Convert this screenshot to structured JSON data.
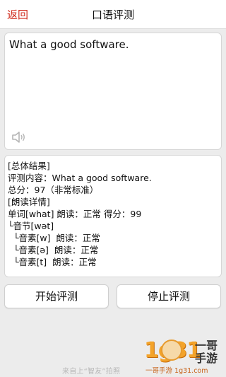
{
  "header": {
    "back_label": "返回",
    "title": "口语评测"
  },
  "input": {
    "text": "What a good software.",
    "speaker_icon": "speaker-icon"
  },
  "result": {
    "lines": [
      "[总体结果]",
      "评测内容：What a good software.",
      "总分：97（非常标准）",
      "",
      "[朗读详情]",
      "单词[what] 朗读：正常 得分：99",
      "└音节[wət]",
      "  └音素[w]  朗读：正常",
      "  └音素[ə]  朗读：正常",
      "  └音素[t]  朗读：正常"
    ]
  },
  "actions": {
    "start_label": "开始评测",
    "stop_label": "停止评测"
  },
  "footer": {
    "note": "来自上“智友”拍照"
  },
  "watermark": {
    "number": "1g31",
    "brand_line1": "一哥",
    "brand_line2": "手游",
    "site": "一哥手游 1g31.com"
  },
  "colors": {
    "accent": "#d02a1c",
    "background": "#ececec",
    "panel": "#ffffff",
    "watermark_orange": "#f3a32a"
  }
}
